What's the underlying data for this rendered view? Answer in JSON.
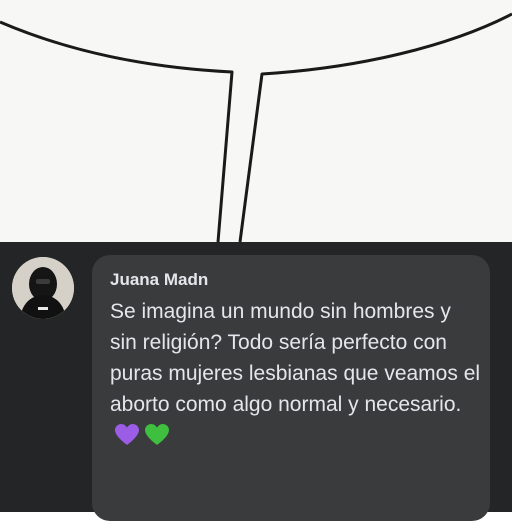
{
  "comment": {
    "author": "Juana Madn",
    "text": "Se imagina un mundo sin hombres y sin religión? Todo sería perfecto con puras mujeres lesbianas que veamos el aborto como algo normal y necesario.",
    "emojis": [
      {
        "name": "purple-heart-icon",
        "color": "#9b5de5"
      },
      {
        "name": "green-heart-icon",
        "color": "#3fbf3f"
      }
    ]
  },
  "colors": {
    "panel_background": "#242526",
    "bubble_background": "#3a3b3c",
    "text": "#e4e6eb"
  }
}
